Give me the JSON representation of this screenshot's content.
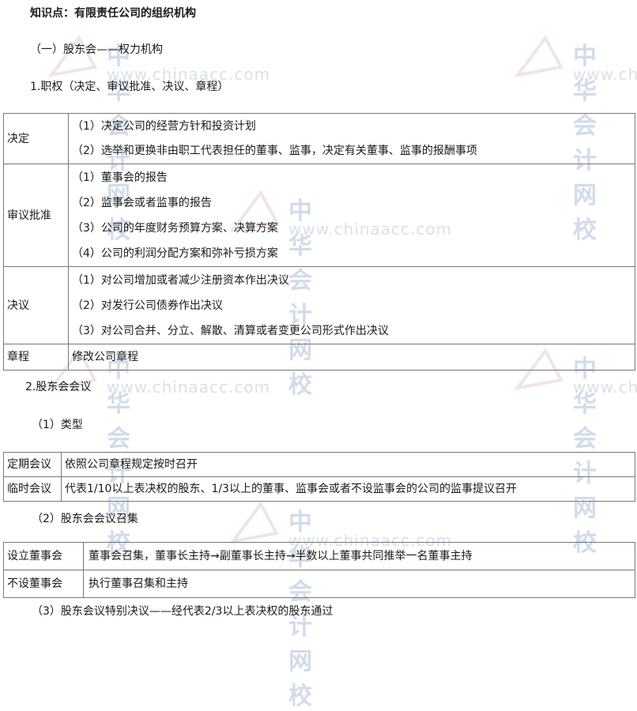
{
  "heading": "知识点：有限责任公司的组织机构",
  "section1": "（一）股东会——权力机构",
  "sub1": "1.职权（决定、审议批准、决议、章程）",
  "powers": [
    {
      "label": "决定",
      "items": [
        "（1）决定公司的经营方针和投资计划",
        "（2）选举和更换非由职工代表担任的董事、监事，决定有关董事、监事的报酬事项"
      ]
    },
    {
      "label": "审议批准",
      "items": [
        "（1）董事会的报告",
        "（2）监事会或者监事的报告",
        "（3）公司的年度财务预算方案、决算方案",
        "（4）公司的利润分配方案和弥补亏损方案"
      ]
    },
    {
      "label": "决议",
      "items": [
        "（1）对公司增加或者减少注册资本作出决议",
        "（2）对发行公司债券作出决议",
        "（3）对公司合并、分立、解散、清算或者变更公司形式作出决议"
      ]
    },
    {
      "label": "章程",
      "items": [
        "修改公司章程"
      ]
    }
  ],
  "sub2": "2.股东会会议",
  "types_heading": "（1）类型",
  "types": [
    {
      "label": "定期会议",
      "text": "依照公司章程规定按时召开"
    },
    {
      "label": "临时会议",
      "text": "代表1/10以上表决权的股东、1/3以上的董事、监事会或者不设监事会的公司的监事提议召开"
    }
  ],
  "convene_heading": "（2）股东会会议召集",
  "convene": [
    {
      "label": "设立董事会",
      "text": "董事会召集，董事长主持→副董事长主持→半数以上董事共同推举一名董事主持"
    },
    {
      "label": "不设董事会",
      "text": "执行董事召集和主持"
    }
  ],
  "special": "（3）股东会议特别决议——经代表2/3以上表决权的股东通过",
  "watermark": {
    "cn": "中华会计网校",
    "en": "www.chinaacc.com",
    "color": "#5f7fb0"
  }
}
